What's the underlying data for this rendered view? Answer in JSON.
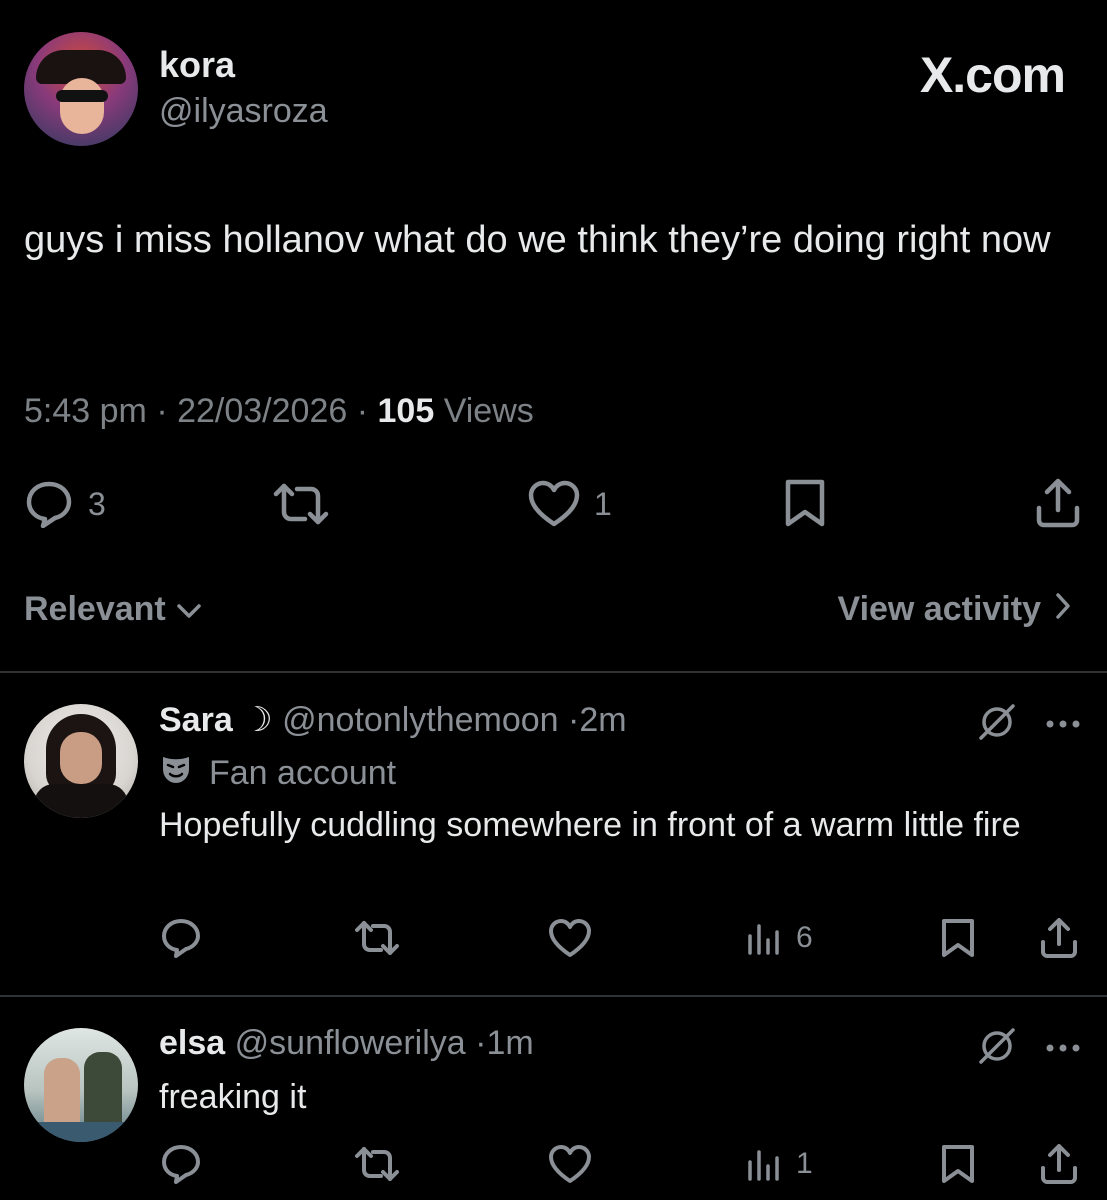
{
  "post": {
    "author_name": "kora",
    "author_handle": "@ilyasroza",
    "brand": "X.com",
    "text": "guys i miss hollanov what do we think they’re doing right now",
    "time": "5:43 pm",
    "date": "22/03/2026",
    "views_count": "105",
    "views_label": "Views",
    "reply_count": "3",
    "like_count": "1"
  },
  "sort": {
    "label": "Relevant",
    "view_activity": "View activity"
  },
  "replies": [
    {
      "name": "Sara",
      "moon": "☽",
      "handle": "@notonlythemoon",
      "time": "2m",
      "label": "Fan account",
      "text": "Hopefully cuddling somewhere in front of a warm little fire",
      "views": "6"
    },
    {
      "name": "elsa",
      "handle": "@sunflowerilya",
      "time": "1m",
      "text": "freaking it",
      "views": "1"
    }
  ],
  "colors": {
    "background": "#000000",
    "text_primary": "#e7e9ea",
    "text_secondary": "#8b9096",
    "divider": "#2f3336"
  },
  "icons": [
    "reply-icon",
    "repost-icon",
    "like-icon",
    "bookmark-icon",
    "share-icon",
    "views-icon",
    "grok-icon",
    "more-icon",
    "chevron-down-icon",
    "chevron-right-icon",
    "mask-icon"
  ]
}
